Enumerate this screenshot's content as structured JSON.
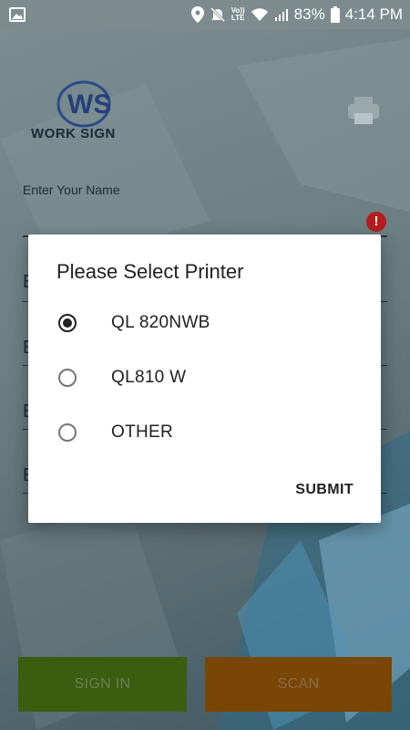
{
  "status_bar": {
    "battery": "83%",
    "time": "4:14 PM",
    "volte_top": "Vo))",
    "volte_bottom": "LTE",
    "icons": [
      "image-icon",
      "location-icon",
      "mute-icon",
      "volte-icon",
      "wifi-icon",
      "signal-icon",
      "battery-icon"
    ]
  },
  "app": {
    "logo_text": "WORK SIGN",
    "name_label": "Enter Your Name",
    "field_stub": "E",
    "error_icon": "!",
    "signin_label": "SIGN IN",
    "scan_label": "SCAN",
    "colors": {
      "signin": "#3a5d10",
      "scan": "#7a4606",
      "error": "#b71c1c"
    }
  },
  "dialog": {
    "title": "Please Select Printer",
    "options": [
      {
        "label": "QL 820NWB",
        "selected": true
      },
      {
        "label": "QL810 W",
        "selected": false
      },
      {
        "label": "OTHER",
        "selected": false
      }
    ],
    "submit_label": "SUBMIT"
  }
}
